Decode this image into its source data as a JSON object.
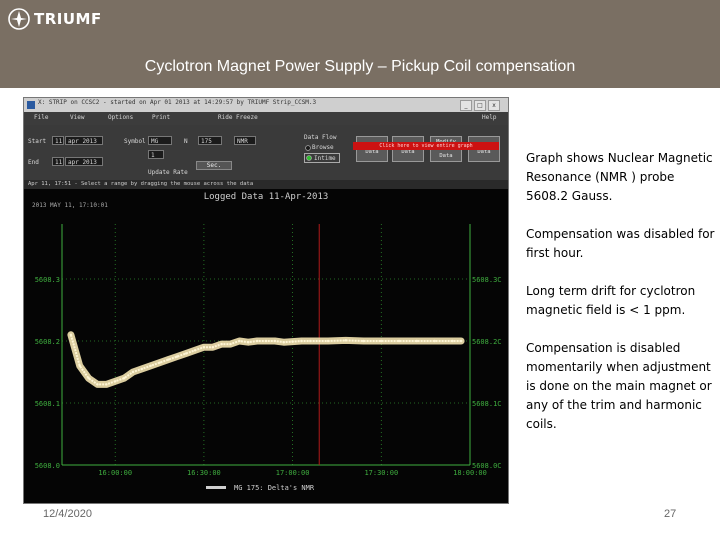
{
  "header": {
    "logo_text": "TRIUMF",
    "title": "Cyclotron Magnet Power Supply – Pickup Coil compensation",
    "background": "#7a6f63"
  },
  "screenshot": {
    "window_title": "X: STRIP on CCSC2 - started on Apr 01 2013 at 14:29:57 by TRIUMF  Strip_CCSM.3",
    "window_buttons": [
      "_",
      "□",
      "x"
    ],
    "menu": [
      "File",
      "View",
      "Options",
      "Print",
      "Ride Freeze",
      "Help"
    ],
    "controls": {
      "start_label": "Start",
      "start_day": "11",
      "start_value": "apr 2013",
      "end_label": "End",
      "end_day": "11",
      "end_value": "apr 2013",
      "symbol_label": "Symbol",
      "symbol_value": "MG",
      "n_label": "N",
      "n_value": "175",
      "source_value": "NMR",
      "rate_value": "1",
      "units_value": "Sec.",
      "update_rate_label": "Update Rate",
      "data_flow_label": "Data Flow",
      "radio_options": [
        "Browse",
        "Intime"
      ],
      "buttons": [
        "Scroll Data",
        "ReStrip Data",
        "Modify Delete Data",
        "Clear Data"
      ],
      "red_notice": "Click here to view entire graph"
    },
    "status_text": "Apr 11, 17:51 - Select a range by dragging the mouse across the data",
    "accent_red": "#cc1111"
  },
  "chart_data": {
    "type": "line",
    "title": "Logged Data   11-Apr-2013",
    "date_label": "2013 MAY 11, 17:10:01",
    "legend": "MG 175: Delta's NMR",
    "line_color": "#f3e3b0",
    "axis_color": "#3fae3f",
    "y_ticks_left": [
      "5608.3",
      "5608.2",
      "5608.1",
      "5608.0"
    ],
    "y_ticks_right": [
      "5608.3C",
      "5608.2C",
      "5608.1C",
      "5608.0C"
    ],
    "x_ticks": [
      "16:00:00",
      "16:30:00",
      "17:00:00",
      "17:30:00",
      "18:00:00"
    ],
    "ylim": [
      5608.0,
      5608.3
    ],
    "x_hours": [
      15.75,
      15.8,
      15.85,
      15.9,
      15.95,
      16.0,
      16.05,
      16.1,
      16.15,
      16.2,
      16.25,
      16.3,
      16.35,
      16.4,
      16.45,
      16.5,
      16.55,
      16.6,
      16.65,
      16.7,
      16.75,
      16.8,
      16.85,
      16.9,
      16.95,
      17.0,
      17.05,
      17.1,
      17.2,
      17.3,
      17.4,
      17.5,
      17.6,
      17.7,
      17.8,
      17.9,
      17.95
    ],
    "values": [
      5608.21,
      5608.16,
      5608.14,
      5608.13,
      5608.13,
      5608.135,
      5608.14,
      5608.15,
      5608.155,
      5608.16,
      5608.165,
      5608.17,
      5608.175,
      5608.18,
      5608.185,
      5608.19,
      5608.19,
      5608.195,
      5608.195,
      5608.2,
      5608.198,
      5608.2,
      5608.2,
      5608.2,
      5608.198,
      5608.199,
      5608.2,
      5608.2,
      5608.2,
      5608.201,
      5608.2,
      5608.2,
      5608.2,
      5608.2,
      5608.2,
      5608.2,
      5608.2
    ],
    "xlim": [
      15.7,
      18.0
    ],
    "marker_line_hour": 17.15
  },
  "notes": [
    "Graph shows Nuclear Magnetic Resonance (NMR ) probe 5608.2 Gauss.",
    "Compensation was disabled for first hour.",
    "Long term drift for cyclotron magnetic field is < 1 ppm.",
    "Compensation is disabled momentarily when adjustment is done on the main magnet or any of the trim and harmonic coils."
  ],
  "footer": {
    "date": "12/4/2020",
    "page": "27"
  }
}
